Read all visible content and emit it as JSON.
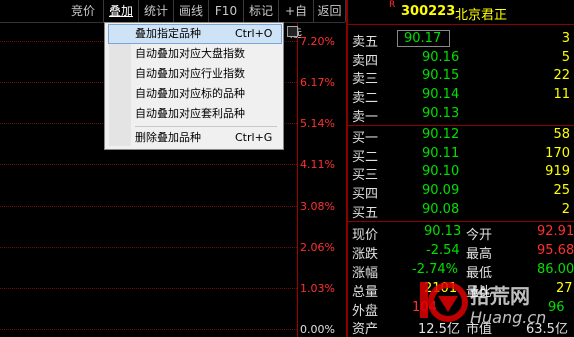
{
  "toolbar": {
    "items": [
      "竞价",
      "叠加",
      "统计",
      "画线",
      "F10",
      "标记",
      "+自选",
      "返回"
    ],
    "active": "叠加"
  },
  "menu": {
    "items": [
      {
        "label": "叠加指定品种",
        "shortcut": "Ctrl+O"
      },
      {
        "label": "自动叠加对应大盘指数",
        "shortcut": ""
      },
      {
        "label": "自动叠加对应行业指数",
        "shortcut": ""
      },
      {
        "label": "自动叠加对应标的品种",
        "shortcut": ""
      },
      {
        "label": "自动叠加对应套利品种",
        "shortcut": ""
      },
      {
        "label": "删除叠加品种",
        "shortcut": "Ctrl+G"
      }
    ]
  },
  "chart": {
    "pct_labels": [
      "7.20%",
      "6.17%",
      "5.14%",
      "4.11%",
      "3.08%",
      "2.06%",
      "1.03%",
      "0.00%"
    ]
  },
  "stock": {
    "badge": "R",
    "code": "300223",
    "name": "北京君正"
  },
  "asks": [
    {
      "label": "卖五",
      "price": "90.17",
      "vol": "3"
    },
    {
      "label": "卖四",
      "price": "90.16",
      "vol": "5"
    },
    {
      "label": "卖三",
      "price": "90.15",
      "vol": "22"
    },
    {
      "label": "卖二",
      "price": "90.14",
      "vol": "11"
    },
    {
      "label": "卖一",
      "price": "90.13",
      "vol": ""
    }
  ],
  "bids": [
    {
      "label": "买一",
      "price": "90.12",
      "vol": "58"
    },
    {
      "label": "买二",
      "price": "90.11",
      "vol": "170"
    },
    {
      "label": "买三",
      "price": "90.10",
      "vol": "919"
    },
    {
      "label": "买四",
      "price": "90.09",
      "vol": "25"
    },
    {
      "label": "买五",
      "price": "90.08",
      "vol": "2"
    }
  ],
  "stats": {
    "now_label": "现价",
    "now": "90.13",
    "open_label": "今开",
    "open": "92.91",
    "chg_label": "涨跌",
    "chg": "-2.54",
    "high_label": "最高",
    "high": "95.68",
    "chgpct_label": "涨幅",
    "chgpct": "-2.74%",
    "low_label": "最低",
    "low": "86.00",
    "vol_label": "总量",
    "vol": "2101",
    "vol2_label": "量比",
    "vol2": "27",
    "outer_label": "外盘",
    "outer": "104",
    "inner": "96",
    "asset_label": "资产",
    "asset": "12.5亿",
    "mktcap_label": "市值",
    "mktcap": "63.5亿"
  },
  "watermark": {
    "brand": "拾荒网",
    "domain": "Huang.cn"
  },
  "colors": {
    "up": "#ff3030",
    "down": "#00e000",
    "volume": "#ffff00",
    "grid": "#8b0000",
    "menu_bg": "#f0f0f0"
  }
}
